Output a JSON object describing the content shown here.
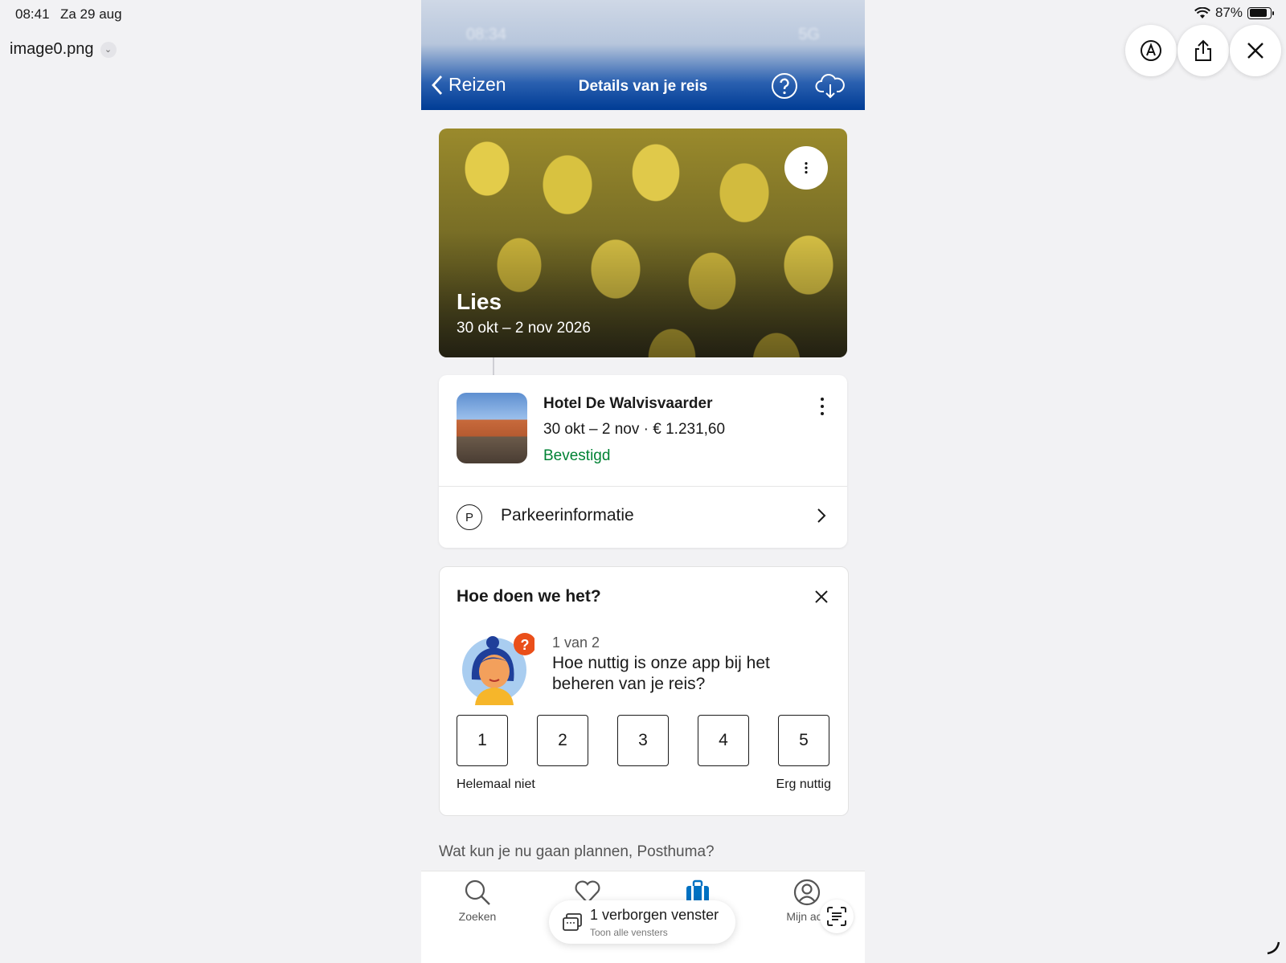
{
  "status_bar": {
    "time": "08:41",
    "date": "Za 29 aug",
    "battery": "87%"
  },
  "quicklook": {
    "filename": "image0.png"
  },
  "phone": {
    "blurred_status": {
      "time": "08:34",
      "network": "5G"
    },
    "nav": {
      "back_label": "Reizen",
      "title": "Details van je reis"
    },
    "hero": {
      "name": "Lies",
      "dates": "30 okt – 2 nov 2026"
    },
    "hotel": {
      "name": "Hotel De Walvisvaarder",
      "meta": "30 okt – 2 nov · € 1.231,60",
      "status": "Bevestigd",
      "parking_label": "Parkeerinformatie",
      "parking_icon_letter": "P"
    },
    "survey": {
      "title": "Hoe doen we het?",
      "step": "1 van 2",
      "question": "Hoe nuttig is onze app bij het beheren van je reis?",
      "options": [
        "1",
        "2",
        "3",
        "4",
        "5"
      ],
      "low_label": "Helemaal niet",
      "high_label": "Erg nuttig"
    },
    "plan_prompt": "Wat kun je nu gaan plannen, Posthuma?",
    "tabs": {
      "search": "Zoeken",
      "account": "Mijn acc"
    }
  },
  "hidden_windows": {
    "label": "1 verborgen venster",
    "sub": "Toon alle vensters"
  },
  "colors": {
    "brand_blue": "#003c95",
    "confirmed_green": "#008234"
  }
}
